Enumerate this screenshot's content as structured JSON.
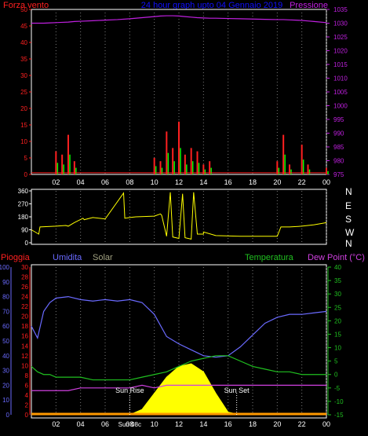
{
  "header": {
    "left_label": "Forza vento",
    "title": "24 hour graph upto  04 Gennaio 2019",
    "right_label": "Pressione"
  },
  "colors": {
    "wind": "#ff2020",
    "gust": "#00ff00",
    "pressure": "#c020e0",
    "direction": "#ffff00",
    "rain": "#ff2020",
    "humidity": "#6a6aff",
    "solar": "#ffff00",
    "temperature": "#20c020",
    "dew_point": "#d040e0",
    "frame": "#ffffff",
    "grid": "#7a7a7a",
    "title": "#1010ff",
    "solar_label": "#a0a080"
  },
  "wind_panel": {
    "left_ticks": [
      "0",
      "5",
      "10",
      "15",
      "20",
      "25",
      "30",
      "35",
      "40",
      "45",
      "50"
    ],
    "right_ticks": [
      "975",
      "980",
      "985",
      "990",
      "995",
      "1000",
      "1005",
      "1010",
      "1015",
      "1020",
      "1025",
      "1030",
      "1035"
    ],
    "x_ticks": [
      "02",
      "04",
      "06",
      "08",
      "10",
      "12",
      "14",
      "16",
      "18",
      "20",
      "22",
      "00"
    ]
  },
  "direction_panel": {
    "left_ticks": [
      "0",
      "90",
      "180",
      "270",
      "360"
    ],
    "compass": [
      "N",
      "W",
      "S",
      "E",
      "N"
    ],
    "x_ticks": [
      "02",
      "04",
      "06",
      "08",
      "10",
      "12",
      "14",
      "16",
      "18",
      "20",
      "22",
      "00"
    ]
  },
  "bottom_panel": {
    "legend": {
      "rain": "Pioggia",
      "humidity": "Umidita",
      "solar": "Solar",
      "temperature": "Temperatura",
      "dew_point": "Dew Point (°C)"
    },
    "humidity_ticks": [
      "0",
      "10",
      "20",
      "30",
      "40",
      "50",
      "60",
      "70",
      "80",
      "90",
      "100"
    ],
    "rain_ticks": [
      "0",
      "2",
      "4",
      "6",
      "8",
      "10",
      "12",
      "14",
      "16",
      "18",
      "20",
      "22",
      "24",
      "26",
      "28",
      "30"
    ],
    "temp_ticks": [
      "-15",
      "-10",
      "-5",
      "0",
      "5",
      "10",
      "15",
      "20",
      "25",
      "30",
      "35",
      "40"
    ],
    "x_ticks": [
      "02",
      "04",
      "06",
      "08",
      "10",
      "12",
      "14",
      "16",
      "18",
      "20",
      "22",
      "00"
    ],
    "sun_rise": "Sun Rise",
    "sun_set": "Sun Set",
    "sun_rise_time": "Sun 08c"
  },
  "chart_data": [
    {
      "type": "line",
      "title": "24 hour graph upto  04 Gennaio 2019",
      "xlabel": "",
      "ylabel": "Forza vento",
      "y2label": "Pressione",
      "ylim": [
        0,
        50
      ],
      "y2lim": [
        975,
        1035
      ],
      "x_hours": [
        0,
        0.5,
        1,
        1.5,
        2,
        2.5,
        3,
        3.5,
        4,
        5,
        6,
        7,
        8,
        9,
        10,
        10.5,
        11,
        11.5,
        12,
        12.5,
        13,
        13.5,
        14,
        14.5,
        15,
        16,
        17,
        18,
        19,
        20,
        20.5,
        21,
        21.5,
        22,
        22.5,
        23,
        24
      ],
      "series": [
        {
          "name": "Forza vento",
          "values": [
            0,
            0,
            0,
            0,
            7,
            6,
            12,
            4,
            0,
            0,
            0,
            0,
            0,
            0,
            5,
            4,
            13,
            8,
            16,
            6,
            8,
            7,
            3,
            4,
            0,
            0,
            0,
            0,
            0,
            4,
            12,
            3,
            0,
            9,
            3,
            0,
            2
          ]
        },
        {
          "name": "Pressione",
          "values": [
            1030.0,
            1030.0,
            1030.0,
            1030.1,
            1030.2,
            1030.3,
            1030.4,
            1030.6,
            1030.7,
            1030.9,
            1031.1,
            1031.3,
            1031.6,
            1032.0,
            1032.4,
            1032.6,
            1032.7,
            1032.7,
            1032.6,
            1032.4,
            1032.2,
            1032.0,
            1031.9,
            1031.8,
            1031.8,
            1031.7,
            1031.6,
            1031.5,
            1031.4,
            1031.3,
            1031.3,
            1031.2,
            1031.1,
            1031.0,
            1030.8,
            1030.6,
            1030.2
          ]
        }
      ]
    },
    {
      "type": "line",
      "title": "",
      "xlabel": "",
      "ylabel": "",
      "ylim": [
        0,
        360
      ],
      "x_hours": [
        0,
        0.6,
        0.7,
        2,
        2.8,
        3,
        3.5,
        4.2,
        4.3,
        5,
        6,
        7.5,
        7.6,
        8,
        8.5,
        10,
        10.5,
        10.6,
        11,
        11.3,
        11.5,
        12,
        12.3,
        12.5,
        13,
        13.2,
        13.5,
        14,
        14,
        15,
        17,
        19,
        20,
        20.3,
        21,
        22,
        23,
        24
      ],
      "series": [
        {
          "name": "",
          "values": [
            90,
            60,
            110,
            115,
            120,
            115,
            140,
            170,
            160,
            175,
            165,
            345,
            170,
            175,
            180,
            185,
            200,
            190,
            45,
            350,
            40,
            30,
            340,
            35,
            25,
            350,
            60,
            60,
            75,
            50,
            45,
            45,
            45,
            110,
            110,
            115,
            125,
            140
          ]
        }
      ]
    },
    {
      "type": "line",
      "title": "",
      "xlabel": "",
      "ylabel": "Umidita",
      "y2label": "Temperatura",
      "ylim": [
        0,
        100
      ],
      "y2lim": [
        -15,
        40
      ],
      "x_hours": [
        0,
        0.5,
        1,
        1.5,
        2,
        3,
        4,
        5,
        6,
        7,
        8,
        9,
        10,
        11,
        12,
        13,
        14,
        15,
        16,
        17,
        18,
        19,
        20,
        21,
        22,
        23,
        24
      ],
      "series": [
        {
          "name": "Umidita",
          "values": [
            60,
            52,
            70,
            76,
            79,
            80,
            78,
            77,
            78,
            77,
            78,
            76,
            68,
            53,
            48,
            44,
            40,
            39,
            40,
            46,
            54,
            62,
            66,
            68,
            68,
            69,
            70
          ]
        },
        {
          "name": "Temperatura",
          "values": [
            3,
            1,
            0,
            0,
            -1,
            -1,
            -1,
            -2,
            -2,
            -2,
            -2,
            -1,
            0,
            1,
            3,
            5,
            6,
            7,
            7,
            5,
            3,
            2,
            1,
            1,
            0,
            0,
            0
          ]
        },
        {
          "name": "Dew Point (°C)",
          "values": [
            -6,
            -6,
            -6,
            -6,
            -6,
            -6,
            -5,
            -5,
            -5,
            -5,
            -5,
            -4,
            -5,
            -4,
            -4,
            -4,
            -4,
            -4,
            -4,
            -4,
            -4,
            -4,
            -4,
            -4,
            -4,
            -4,
            -4
          ]
        },
        {
          "name": "Solar",
          "values": [
            0,
            0,
            0,
            0,
            0,
            0,
            0,
            0,
            0,
            0,
            0,
            2,
            8,
            14,
            18,
            19,
            16,
            8,
            1,
            0,
            0,
            0,
            0,
            0,
            0,
            0,
            0
          ]
        },
        {
          "name": "Pioggia",
          "values": [
            0,
            0,
            0,
            0,
            0,
            0,
            0,
            0,
            0,
            0,
            0,
            0,
            0,
            0,
            0,
            0,
            0,
            0,
            0,
            0,
            0,
            0,
            0,
            0,
            0,
            0,
            0
          ]
        }
      ]
    }
  ]
}
